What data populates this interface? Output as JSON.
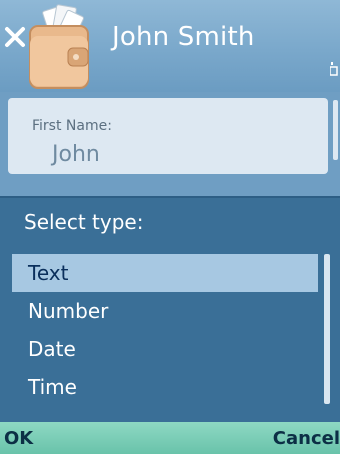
{
  "titlebar": {
    "title": "John Smith"
  },
  "icons": {
    "close": "close-icon",
    "wallet": "wallet-icon",
    "corner": "signal-indicator-icon"
  },
  "form": {
    "field_label": "First Name:",
    "field_value": "John"
  },
  "popup": {
    "title": "Select type:",
    "items": [
      {
        "label": "Text",
        "selected": true
      },
      {
        "label": "Number",
        "selected": false
      },
      {
        "label": "Date",
        "selected": false
      },
      {
        "label": "Time",
        "selected": false
      }
    ]
  },
  "softkeys": {
    "left": "OK",
    "right": "Cancel"
  },
  "colors": {
    "titlebar": "#7aa8cb",
    "popup_bg": "#3a6f97",
    "selection": "#a7c8e2",
    "softkey_bar": "#69c3aa"
  }
}
